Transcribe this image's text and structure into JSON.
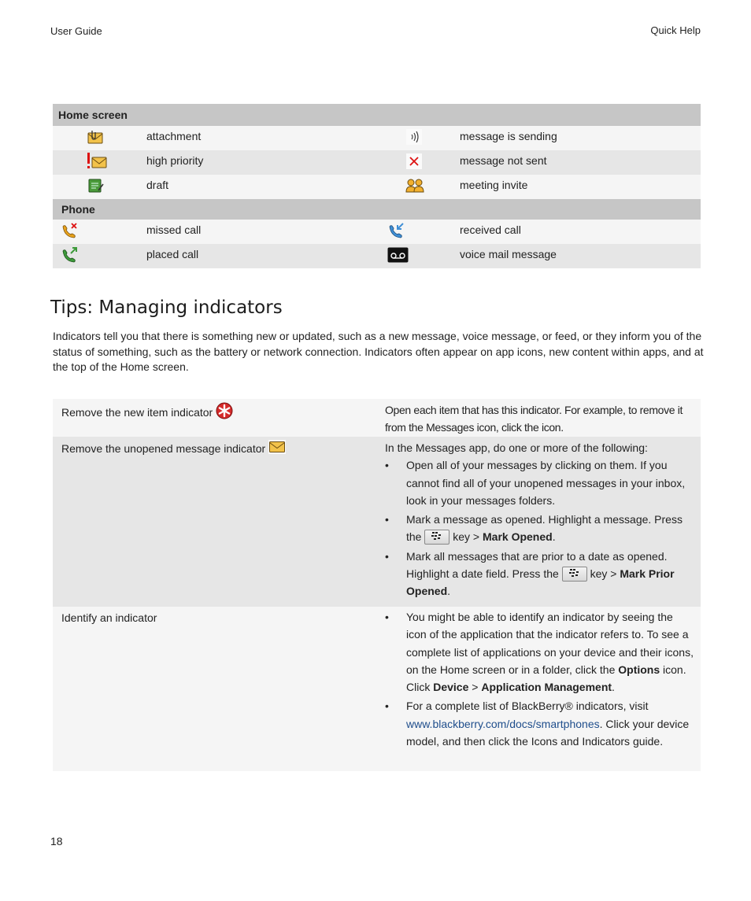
{
  "header": {
    "left": "User Guide",
    "right": "Quick Help"
  },
  "page_number": "18",
  "icon_table": {
    "sections": [
      {
        "title": "Home screen",
        "rows": [
          {
            "left": {
              "icon": "attachment-icon",
              "label": "attachment"
            },
            "right": {
              "icon": "message-sending-icon",
              "label": "message is sending"
            }
          },
          {
            "left": {
              "icon": "high-priority-icon",
              "label": "high priority"
            },
            "right": {
              "icon": "message-not-sent-icon",
              "label": "message not sent"
            }
          },
          {
            "left": {
              "icon": "draft-icon",
              "label": "draft"
            },
            "right": {
              "icon": "meeting-invite-icon",
              "label": "meeting invite"
            }
          }
        ]
      },
      {
        "title": "Phone",
        "rows": [
          {
            "left": {
              "icon": "missed-call-icon",
              "label": "missed call"
            },
            "right": {
              "icon": "received-call-icon",
              "label": "received call"
            }
          },
          {
            "left": {
              "icon": "placed-call-icon",
              "label": "placed call"
            },
            "right": {
              "icon": "voice-mail-icon",
              "label": "voice mail message"
            }
          }
        ]
      }
    ]
  },
  "tips": {
    "title": "Tips: Managing indicators",
    "intro": "Indicators tell you that there is something new or updated, such as a new message, voice message, or feed, or they inform you of the status of something, such as the battery or network connection. Indicators often appear on app icons, new content within apps, and at the top of the Home screen.",
    "rows": [
      {
        "task": "Remove the new item indicator",
        "icon": "new-item-indicator-icon",
        "text": "Open each item that has this indicator. For example, to remove it from the Messages icon, click the icon."
      },
      {
        "task": "Remove the unopened message indicator",
        "icon": "unopened-message-icon",
        "lead": "In the Messages app, do one or more of the following:",
        "bullets": [
          {
            "text": "Open all of your messages by clicking on them. If you cannot find all of your unopened messages in your inbox, look in your messages folders."
          },
          {
            "pre": "Mark a message as opened. Highlight a message. Press the",
            "post": "key >",
            "bold": "Mark Opened",
            "end": "."
          },
          {
            "pre": "Mark all messages that are prior to a date as opened. Highlight a date field. Press the",
            "post": "key >",
            "bold": "Mark Prior Opened",
            "end": "."
          }
        ]
      },
      {
        "task": "Identify an indicator",
        "bullets": [
          {
            "t1": "You might be able to identify an indicator by seeing the icon of the application that the indicator refers to. To see a complete list of applications on your device and their icons, on the Home screen or in a folder, click the",
            "b1": "Options",
            "t2": "icon. Click",
            "b2": "Device",
            "t3": ">",
            "b3": "Application Management",
            "t4": "."
          },
          {
            "t1": "For a complete list of BlackBerry® indicators, visit",
            "link": "www.blackberry.com/docs/smartphones",
            "t2": ". Click your device model, and then click the Icons and Indicators guide."
          }
        ]
      }
    ],
    "bullet": "•"
  },
  "colors": {
    "section_header": "#c6c6c6",
    "row_light": "#f5f5f5",
    "row_dark": "#e6e6e6",
    "link": "#1f4e8c"
  }
}
